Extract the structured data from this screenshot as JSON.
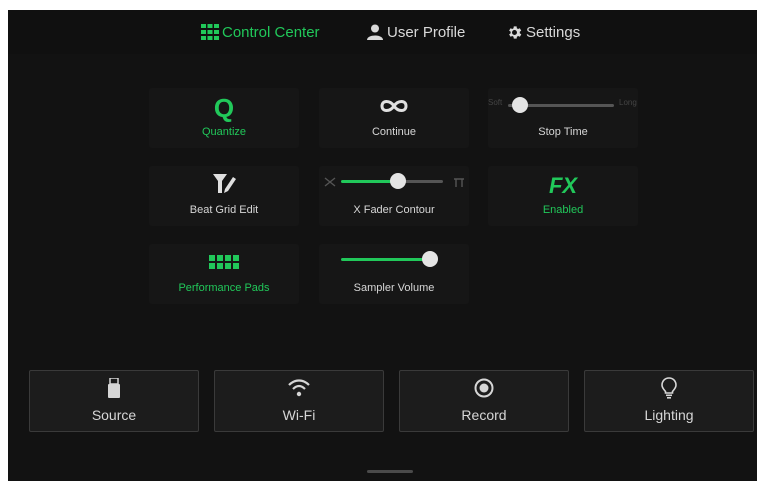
{
  "tabs": [
    {
      "label": "Control Center",
      "icon": "grid-icon",
      "active": true
    },
    {
      "label": "User Profile",
      "icon": "user-icon",
      "active": false
    },
    {
      "label": "Settings",
      "icon": "gear-icon",
      "active": false
    }
  ],
  "tiles": {
    "quantize": {
      "icon_text": "Q",
      "label": "Quantize",
      "state": "on"
    },
    "continue": {
      "icon": "infinity-icon",
      "label": "Continue"
    },
    "stop_time": {
      "label": "Stop Time",
      "min_label": "Soft",
      "max_label": "Long",
      "value": 0.15
    },
    "beat_grid_edit": {
      "icon": "edit-grid-icon",
      "label": "Beat Grid Edit"
    },
    "x_fader_contour": {
      "label": "X Fader Contour",
      "value": 0.55,
      "left_icon": "cross-curve-icon",
      "right_icon": "sharp-curve-icon"
    },
    "fx": {
      "icon_text": "FX",
      "label": "Enabled"
    },
    "performance_pads": {
      "icon": "pads-icon",
      "label": "Performance Pads",
      "state": "on"
    },
    "sampler_volume": {
      "label": "Sampler Volume",
      "value": 1.0
    }
  },
  "bottom": [
    {
      "label": "Source",
      "icon": "usb-drive-icon"
    },
    {
      "label": "Wi-Fi",
      "icon": "wifi-icon"
    },
    {
      "label": "Record",
      "icon": "record-icon"
    },
    {
      "label": "Lighting",
      "icon": "lightbulb-icon"
    }
  ],
  "colors": {
    "accent": "#21c85a",
    "background": "#121212",
    "tile": "#161616",
    "text": "#d6d6d6"
  }
}
